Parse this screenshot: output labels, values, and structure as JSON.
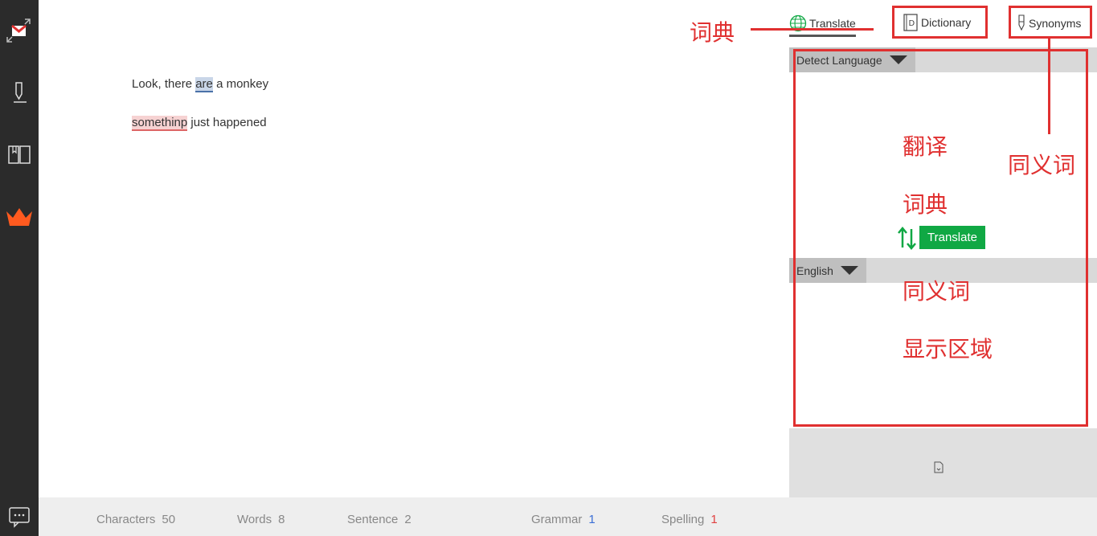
{
  "sidebar": {
    "icons": [
      "gmail-collapse-icon",
      "pen-icon",
      "book-icon",
      "crown-icon",
      "chat-icon"
    ],
    "accent": "#ff5a1f"
  },
  "editor": {
    "lines": [
      {
        "before": "Look, there ",
        "flag": "are",
        "after": " a monkey",
        "flag_type": "grammar"
      },
      {
        "before": "",
        "flag": "somethinp",
        "after": " just happened",
        "flag_type": "spelling"
      }
    ]
  },
  "status": {
    "characters_label": "Characters",
    "characters": "50",
    "words_label": "Words",
    "words": "8",
    "sentence_label": "Sentence",
    "sentence": "2",
    "grammar_label": "Grammar",
    "grammar": "1",
    "spelling_label": "Spelling",
    "spelling": "1"
  },
  "panel": {
    "tabs": {
      "translate": "Translate",
      "dictionary": "Dictionary",
      "synonyms": "Synonyms"
    },
    "source_lang": "Detect Language",
    "target_lang": "English",
    "translate_button": "Translate"
  },
  "annotations": {
    "dictionary": "词典",
    "synonyms": "同义词",
    "area_1": "翻译",
    "area_2": "词典",
    "area_3": "同义词",
    "area_4": "显示区域"
  },
  "colors": {
    "annotation": "#e03030",
    "translate_green": "#10a844",
    "grammar_count": "#3b6fd6",
    "spelling_count": "#e04040"
  }
}
